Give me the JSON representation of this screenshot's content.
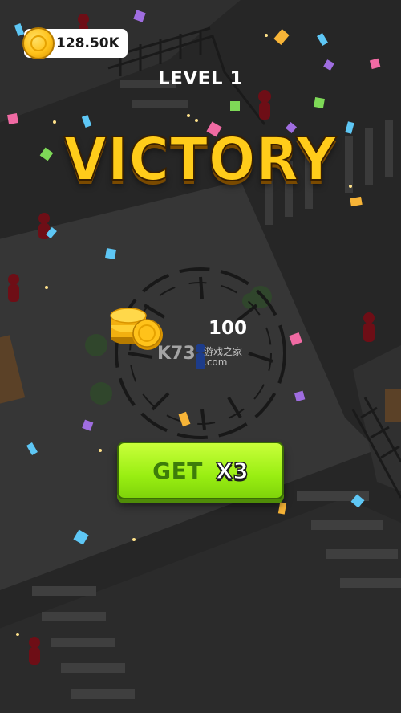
{
  "hud": {
    "coin_balance": "128.50K",
    "coin_icon": "coin-icon"
  },
  "result": {
    "level_label": "LEVEL 1",
    "title": "VICTORY",
    "reward_amount": "100",
    "reward_icon": "coin-stack-icon"
  },
  "action": {
    "get_label": "GET",
    "multiplier_label": "X3"
  },
  "watermark": {
    "brand": "K73",
    "caption": "游戏之家",
    "domain": ".com"
  },
  "colors": {
    "background": "#262626",
    "road": "#2d2d2d",
    "victory_gold": "#ffcc1a",
    "button_green": "#99ee12"
  }
}
